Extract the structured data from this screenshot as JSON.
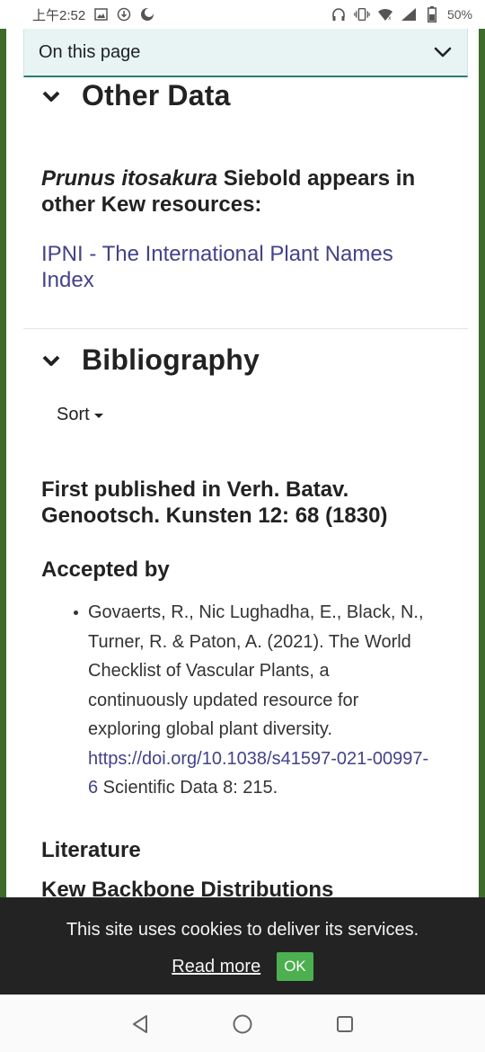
{
  "status_bar": {
    "time": "上午2:52",
    "battery": "50%",
    "left_icons": [
      "image-icon",
      "download-icon",
      "moon-icon"
    ],
    "right_icons": [
      "headphones-icon",
      "vibrate-icon",
      "wifi-icon",
      "signal-icon",
      "battery-icon"
    ]
  },
  "on_this_page": {
    "label": "On this page",
    "icon": "chevron-down-icon"
  },
  "other_data": {
    "title": "Other Data",
    "species_name": "Prunus itosakura",
    "species_author_text": " Siebold appears in other Kew resources:",
    "ipni_link": "IPNI - The International Plant Names Index"
  },
  "bibliography": {
    "title": "Bibliography",
    "sort_label": "Sort",
    "first_published": "First published in Verh. Batav. Genootsch. Kunsten 12: 68 (1830)",
    "accepted_by_heading": "Accepted by",
    "reference": {
      "text": "Govaerts, R., Nic Lughadha, E., Black, N., Turner, R. & Paton, A. (2021). The World Checklist of Vascular Plants, a continuously updated resource for exploring global plant diversity. ",
      "doi_link": "https://doi.org/10.1038/s41597-021-00997-6",
      "suffix": " Scientific Data 8: 215."
    },
    "literature_heading": "Literature",
    "kew_backbone_heading": "Kew Backbone Distributions"
  },
  "cookie_banner": {
    "message": "This site uses cookies to deliver its services.",
    "read_more": "Read more",
    "ok": "OK"
  },
  "nav_bar": {
    "buttons": [
      "back-triangle-icon",
      "home-circle-icon",
      "recents-square-icon"
    ]
  },
  "colors": {
    "frame_green": "#3e6b2b",
    "link": "#43428a",
    "ok_green": "#4caf50",
    "banner_bg": "#232323",
    "otp_bg": "#e8f4f4",
    "otp_border": "#2b7a7a"
  }
}
